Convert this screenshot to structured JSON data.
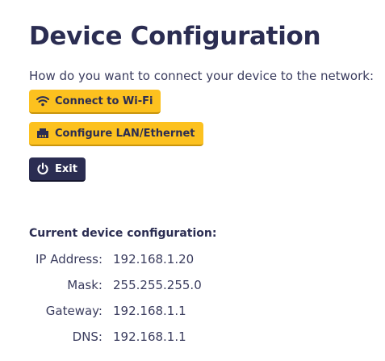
{
  "page": {
    "title": "Device Configuration",
    "prompt": "How do you want to connect your device to the network:"
  },
  "buttons": {
    "wifi": {
      "label": "Connect to Wi-Fi",
      "icon": "wifi-icon"
    },
    "lan": {
      "label": "Configure LAN/Ethernet",
      "icon": "ethernet-port-icon"
    },
    "exit": {
      "label": "Exit",
      "icon": "power-icon"
    }
  },
  "config": {
    "title": "Current device configuration:",
    "rows": [
      {
        "label": "IP Address:",
        "value": "192.168.1.20"
      },
      {
        "label": "Mask:",
        "value": "255.255.255.0"
      },
      {
        "label": "Gateway:",
        "value": "192.168.1.1"
      },
      {
        "label": "DNS:",
        "value": "192.168.1.1"
      }
    ]
  },
  "colors": {
    "primary_dark": "#2b2d52",
    "accent_yellow": "#fcc11f",
    "text": "#3a3c5e"
  }
}
